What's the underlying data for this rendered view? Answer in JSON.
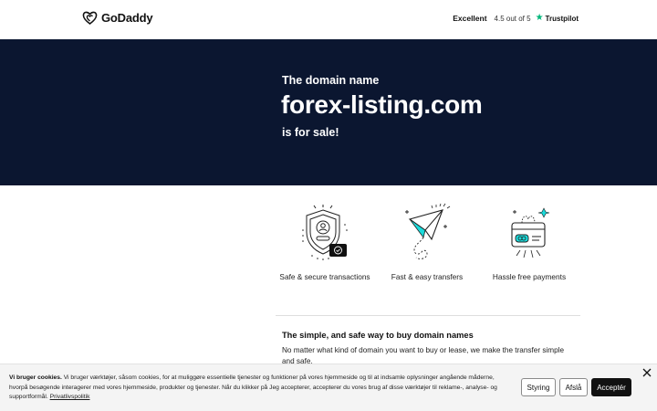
{
  "header": {
    "brand": "GoDaddy",
    "trustpilot": {
      "rating_word": "Excellent",
      "score_text": "4.5 out of 5",
      "brand": "Trustpilot"
    }
  },
  "hero": {
    "intro": "The domain name",
    "domain": "forex-listing.com",
    "suffix": "is for sale!"
  },
  "features": [
    {
      "icon": "shield-icon",
      "label": "Safe & secure transactions"
    },
    {
      "icon": "paper-plane-icon",
      "label": "Fast & easy transfers"
    },
    {
      "icon": "credit-card-icon",
      "label": "Hassle free payments"
    }
  ],
  "info": {
    "title": "The simple, and safe way to buy domain names",
    "text": "No matter what kind of domain you want to buy or lease, we make the transfer simple and safe."
  },
  "cookie": {
    "heading": "Vi bruger cookies.",
    "body": " Vi bruger værktøjer, såsom cookies, for at muliggøre essentielle tjenester og funktioner på vores hjemmeside og til at indsamle oplysninger angående måderne, hvorpå besøgende interagerer med vores hjemmeside, produkter og tjenester. Når du klikker på Jeg accepterer, accepterer du vores brug af disse værktøjer til reklame-, analyse- og supportformål. ",
    "policy_link": "Privatlivspolitik",
    "buttons": {
      "manage": "Styring",
      "decline": "Afslå",
      "accept": "Acceptér"
    }
  },
  "colors": {
    "hero_background": "#0b1630",
    "accent_teal": "#1bdbdb",
    "trustpilot_green": "#00b67a"
  }
}
